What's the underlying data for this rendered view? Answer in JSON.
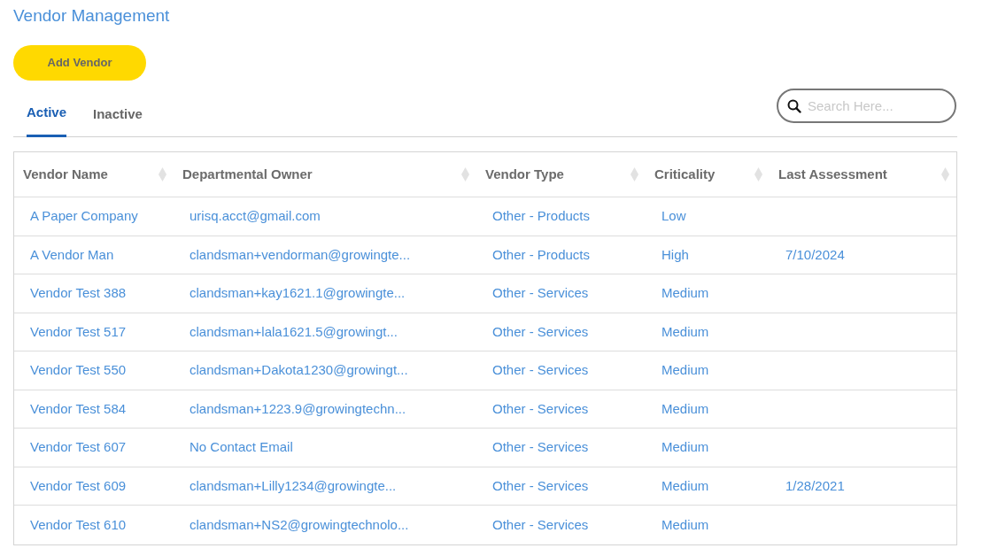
{
  "page": {
    "title": "Vendor Management"
  },
  "add_button": {
    "label": "Add Vendor"
  },
  "tabs": [
    {
      "label": "Active",
      "selected": true
    },
    {
      "label": "Inactive",
      "selected": false
    }
  ],
  "search": {
    "placeholder": "Search Here..."
  },
  "table": {
    "columns": [
      "Vendor Name",
      "Departmental Owner",
      "Vendor Type",
      "Criticality",
      "Last Assessment"
    ],
    "rows": [
      {
        "vendor_name": "A Paper Company",
        "departmental_owner": "urisq.acct@gmail.com",
        "vendor_type": "Other - Products",
        "criticality": "Low"
      },
      {
        "vendor_name": "A Vendor Man",
        "departmental_owner": "clandsman+vendorman@growingte...",
        "vendor_type": "Other - Products",
        "criticality": "High",
        "last_assessment": "7/10/2024"
      },
      {
        "vendor_name": "Vendor Test 388",
        "departmental_owner": "clandsman+kay1621.1@growingte...",
        "vendor_type": "Other - Services",
        "criticality": "Medium"
      },
      {
        "vendor_name": "Vendor Test 517",
        "departmental_owner": "clandsman+lala1621.5@growingt...",
        "vendor_type": "Other - Services",
        "criticality": "Medium"
      },
      {
        "vendor_name": "Vendor Test 550",
        "departmental_owner": "clandsman+Dakota1230@growingt...",
        "vendor_type": "Other - Services",
        "criticality": "Medium"
      },
      {
        "vendor_name": "Vendor Test 584",
        "departmental_owner": "clandsman+1223.9@growingtechn...",
        "vendor_type": "Other - Services",
        "criticality": "Medium"
      },
      {
        "vendor_name": "Vendor Test 607",
        "departmental_owner": "No Contact Email",
        "vendor_type": "Other - Services",
        "criticality": "Medium"
      },
      {
        "vendor_name": "Vendor Test 609",
        "departmental_owner": "clandsman+Lilly1234@growingte...",
        "vendor_type": "Other - Services",
        "criticality": "Medium",
        "last_assessment": "1/28/2021"
      },
      {
        "vendor_name": "Vendor Test 610",
        "departmental_owner": "clandsman+NS2@growingtechnolo...",
        "vendor_type": "Other - Services",
        "criticality": "Medium"
      }
    ]
  }
}
